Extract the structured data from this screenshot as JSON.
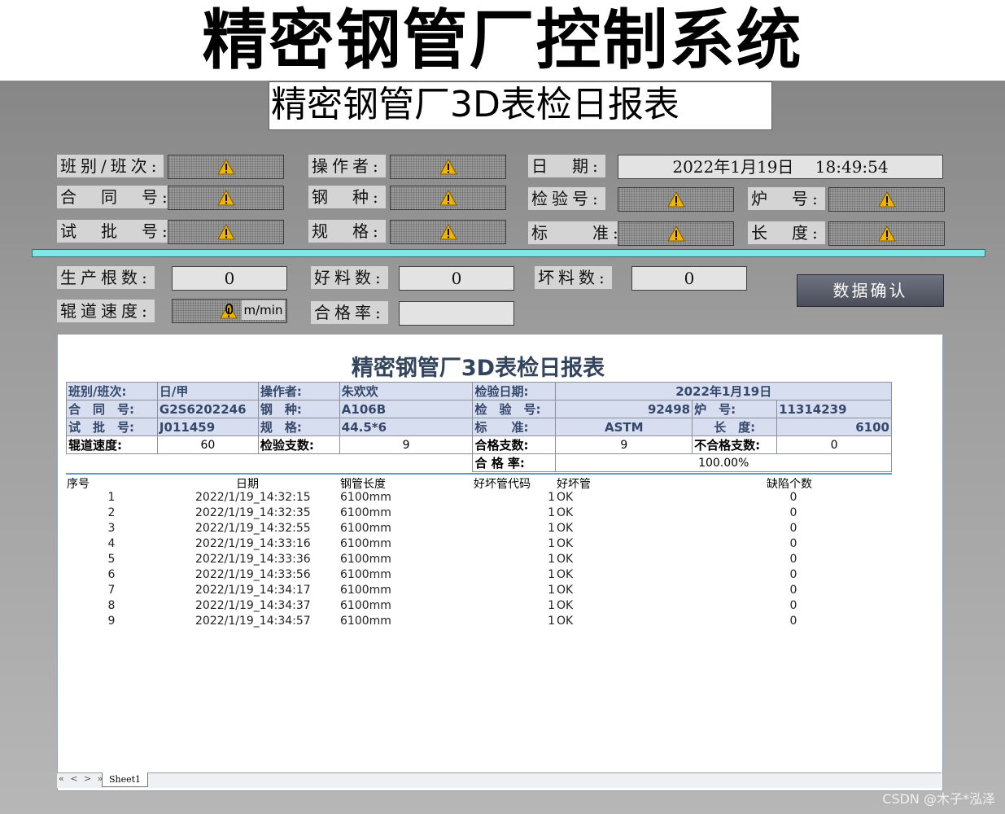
{
  "app": {
    "title": "精密钢管厂控制系统",
    "subtitle": "精密钢管厂3D表检日报表"
  },
  "form": {
    "shift_label": "班别/班次:",
    "operator_label": "操作者:",
    "date_label": "日　期:",
    "date_value": "2022年1月19日　 18:49:54",
    "contract_label": "合　同　号:",
    "steel_label": "钢　种:",
    "inspect_label": "检验号:",
    "furnace_label": "炉　号:",
    "batch_label": "试　批　号:",
    "spec_label": "规　格:",
    "standard_label": "标　　准:",
    "length_label": "长　度:",
    "prod_count_label": "生产根数:",
    "prod_count_value": "0",
    "good_count_label": "好料数:",
    "good_count_value": "0",
    "bad_count_label": "坏料数:",
    "bad_count_value": "0",
    "speed_label": "辊道速度:",
    "speed_value": "0",
    "speed_unit": "m/min",
    "pass_rate_label": "合格率:",
    "pass_rate_value": "",
    "confirm_button": "数据确认"
  },
  "report": {
    "title": "精密钢管厂3D表检日报表",
    "header": {
      "shift_label": "班别/班次:",
      "shift_value": "日/甲",
      "operator_label": "操作者:",
      "operator_value": "朱欢欢",
      "inspect_date_label": "检验日期:",
      "inspect_date_value": "2022年1月19日",
      "contract_label": "合　同　号:",
      "contract_value": "G2S6202246",
      "steel_label": "钢　种:",
      "steel_value": "A106B",
      "inspect_no_label": "检　验　号:",
      "inspect_no_value": "92498",
      "furnace_label": "炉　号:",
      "furnace_value": "11314239",
      "batch_label": "试　批　号:",
      "batch_value": "J011459",
      "spec_label": "规　格:",
      "spec_value": "44.5*6",
      "standard_label": "标　　准:",
      "standard_value": "ASTM",
      "length_label": "长　度:",
      "length_value": "6100",
      "speed_label": "辊道速度:",
      "speed_value": "60",
      "inspect_count_label": "检验支数:",
      "inspect_count_value": "9",
      "pass_count_label": "合格支数:",
      "pass_count_value": "9",
      "fail_count_label": "不合格支数:",
      "fail_count_value": "0",
      "pass_rate_label": "合 格 率:",
      "pass_rate_value": "100.00%"
    },
    "columns": [
      "序号",
      "日期",
      "钢管长度",
      "好坏管代码",
      "好坏管",
      "缺陷个数"
    ],
    "rows": [
      {
        "no": "1",
        "date": "2022/1/19_14:32:15",
        "length": "6100mm",
        "code": "1",
        "status": "OK",
        "defects": "0"
      },
      {
        "no": "2",
        "date": "2022/1/19_14:32:35",
        "length": "6100mm",
        "code": "1",
        "status": "OK",
        "defects": "0"
      },
      {
        "no": "3",
        "date": "2022/1/19_14:32:55",
        "length": "6100mm",
        "code": "1",
        "status": "OK",
        "defects": "0"
      },
      {
        "no": "4",
        "date": "2022/1/19_14:33:16",
        "length": "6100mm",
        "code": "1",
        "status": "OK",
        "defects": "0"
      },
      {
        "no": "5",
        "date": "2022/1/19_14:33:36",
        "length": "6100mm",
        "code": "1",
        "status": "OK",
        "defects": "0"
      },
      {
        "no": "6",
        "date": "2022/1/19_14:33:56",
        "length": "6100mm",
        "code": "1",
        "status": "OK",
        "defects": "0"
      },
      {
        "no": "7",
        "date": "2022/1/19_14:34:17",
        "length": "6100mm",
        "code": "1",
        "status": "OK",
        "defects": "0"
      },
      {
        "no": "8",
        "date": "2022/1/19_14:34:37",
        "length": "6100mm",
        "code": "1",
        "status": "OK",
        "defects": "0"
      },
      {
        "no": "9",
        "date": "2022/1/19_14:34:57",
        "length": "6100mm",
        "code": "1",
        "status": "OK",
        "defects": "0"
      }
    ],
    "sheet_nav": "« < > »",
    "sheet_tab": "Sheet1"
  },
  "watermark": "CSDN @木子*泓泽",
  "colors": {
    "warning": "#f0b400",
    "divider": "#7ee7e7",
    "report_title": "#33445e"
  },
  "icons": {
    "warning": "warning-icon"
  }
}
